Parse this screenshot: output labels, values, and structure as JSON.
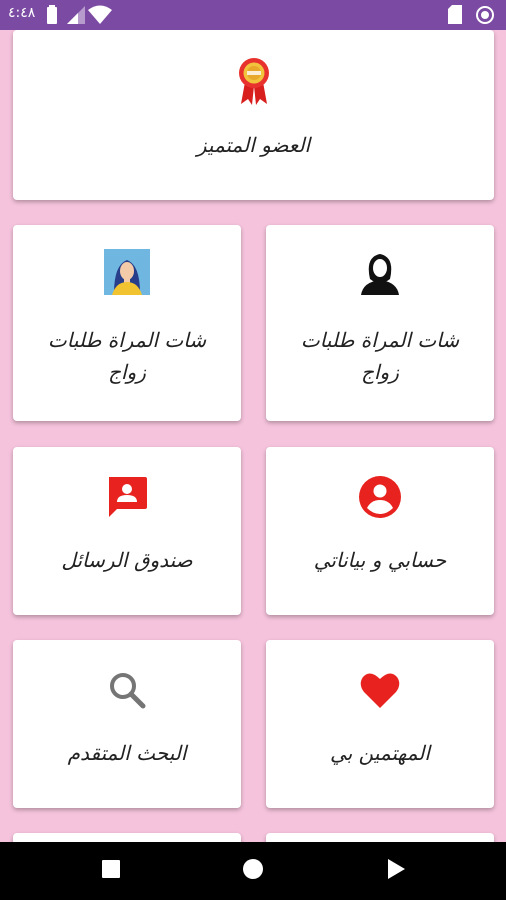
{
  "status_bar": {
    "time": "٤:٤٨",
    "icons": [
      "battery-icon",
      "signal-icon",
      "wifi-icon",
      "sd-card-icon",
      "sync-icon"
    ]
  },
  "cards": {
    "featured_member": {
      "label": "العضو المتميز",
      "icon": "ribbon-badge-icon"
    },
    "women_chat_1": {
      "label": "شات المراة طلبات زواج",
      "icon": "woman-avatar-icon"
    },
    "women_chat_2": {
      "label": "شات المراة طلبات زواج",
      "icon": "woman-silhouette-icon"
    },
    "inbox": {
      "label": "صندوق الرسائل",
      "icon": "contact-message-icon"
    },
    "my_account": {
      "label": "حسابي و بياناتي",
      "icon": "account-circle-icon"
    },
    "advanced_search": {
      "label": "البحث المتقدم",
      "icon": "search-icon"
    },
    "interested_in_me": {
      "label": "المهتمين بي",
      "icon": "heart-icon"
    }
  },
  "colors": {
    "status_bar": "#7b4aa2",
    "background": "#f5c3dc",
    "accent_red": "#e8231f",
    "navbar": "#000000"
  },
  "nav_bar": {
    "buttons": [
      "recents-square-icon",
      "home-circle-icon",
      "back-triangle-icon"
    ]
  }
}
